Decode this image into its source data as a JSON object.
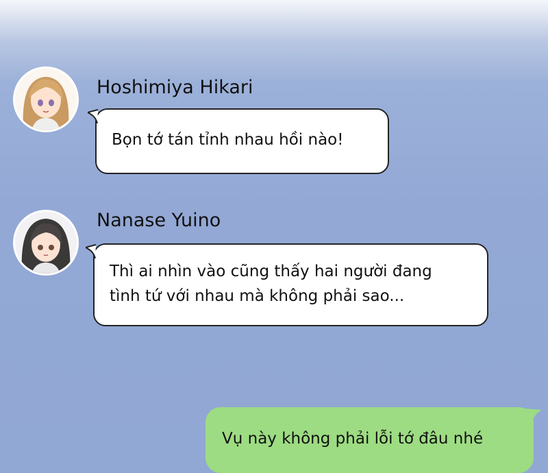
{
  "colors": {
    "background_top": "#f4f6fa",
    "background": "#93a8d5",
    "incoming_bubble": "#ffffff",
    "incoming_border": "#222222",
    "outgoing_bubble": "#9ddc82",
    "text": "#111111"
  },
  "messages": [
    {
      "sender": "Hoshimiya Hikari",
      "avatar": "hikari-avatar",
      "text": "Bọn tớ tán tỉnh nhau hồi nào!"
    },
    {
      "sender": "Nanase Yuino",
      "avatar": "yuino-avatar",
      "text": "Thì ai nhìn vào cũng thấy hai người đang\ntình tứ với nhau mà không phải sao..."
    }
  ],
  "own_message": {
    "text": "Vụ này không phải lỗi tớ đâu nhé"
  }
}
